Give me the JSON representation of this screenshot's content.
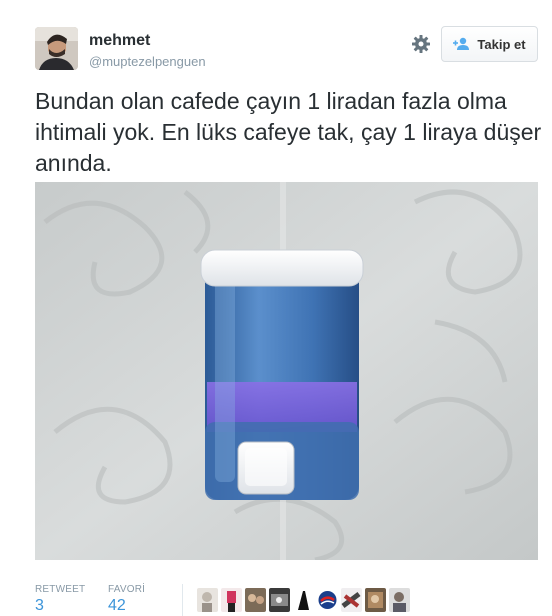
{
  "user": {
    "name": "mehmet",
    "handle": "@muptezelpenguen"
  },
  "actions": {
    "follow_label": "Takip et"
  },
  "tweet": {
    "text": "Bundan olan cafede çayın 1 liradan fazla olma ihtimali yok. En lüks cafeye tak, çay 1 liraya düşer anında."
  },
  "stats": {
    "retweet_label": "RETWEET",
    "retweet_count": "3",
    "favorite_label": "FAVORİ",
    "favorite_count": "42"
  },
  "icons": {
    "gear": "gear-icon",
    "follow": "add-user-icon"
  },
  "colors": {
    "link": "#3b94d9",
    "muted": "#8899a6",
    "text": "#292f33"
  }
}
